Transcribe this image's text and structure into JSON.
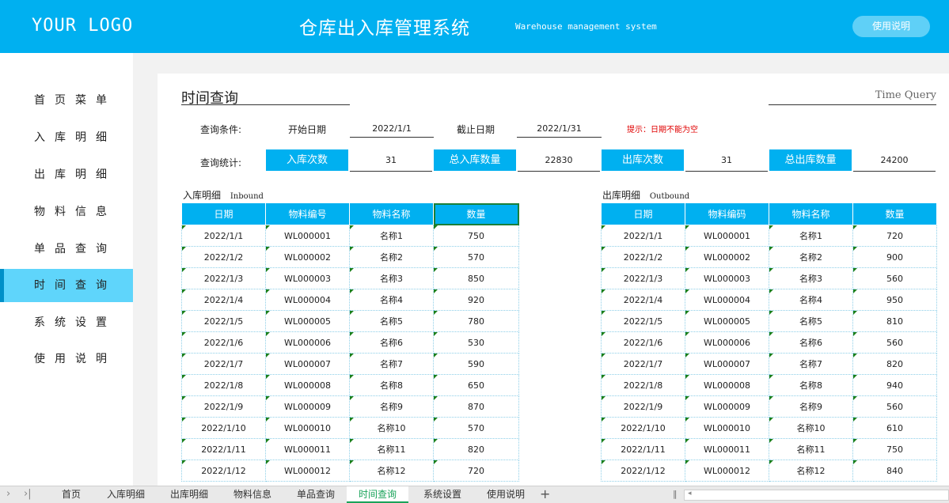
{
  "header": {
    "logo": "YOUR LOGO",
    "title": "仓库出入库管理系统",
    "subtitle": "Warehouse management system",
    "help_button": "使用说明"
  },
  "sidebar": {
    "items": [
      {
        "label": "首页菜单",
        "active": false
      },
      {
        "label": "入库明细",
        "active": false
      },
      {
        "label": "出库明细",
        "active": false
      },
      {
        "label": "物料信息",
        "active": false
      },
      {
        "label": "单品查询",
        "active": false
      },
      {
        "label": "时间查询",
        "active": true
      },
      {
        "label": "系统设置",
        "active": false
      },
      {
        "label": "使用说明",
        "active": false
      }
    ]
  },
  "query": {
    "title": "时间查询",
    "title_en": "Time Query",
    "condition_label": "查询条件:",
    "start_label": "开始日期",
    "start_value": "2022/1/1",
    "end_label": "截止日期",
    "end_value": "2022/1/31",
    "tip": "提示：日期不能为空",
    "stats_label": "查询统计:",
    "stats": [
      {
        "label": "入库次数",
        "value": "31"
      },
      {
        "label": "总入库数量",
        "value": "22830"
      },
      {
        "label": "出库次数",
        "value": "31"
      },
      {
        "label": "总出库数量",
        "value": "24200"
      }
    ]
  },
  "inbound": {
    "title": "入库明细",
    "title_en": "Inbound",
    "columns": [
      "日期",
      "物料编号",
      "物料名称",
      "数量"
    ],
    "rows": [
      [
        "2022/1/1",
        "WL000001",
        "名称1",
        "750"
      ],
      [
        "2022/1/2",
        "WL000002",
        "名称2",
        "570"
      ],
      [
        "2022/1/3",
        "WL000003",
        "名称3",
        "850"
      ],
      [
        "2022/1/4",
        "WL000004",
        "名称4",
        "920"
      ],
      [
        "2022/1/5",
        "WL000005",
        "名称5",
        "780"
      ],
      [
        "2022/1/6",
        "WL000006",
        "名称6",
        "530"
      ],
      [
        "2022/1/7",
        "WL000007",
        "名称7",
        "590"
      ],
      [
        "2022/1/8",
        "WL000008",
        "名称8",
        "650"
      ],
      [
        "2022/1/9",
        "WL000009",
        "名称9",
        "870"
      ],
      [
        "2022/1/10",
        "WL000010",
        "名称10",
        "570"
      ],
      [
        "2022/1/11",
        "WL000011",
        "名称11",
        "820"
      ],
      [
        "2022/1/12",
        "WL000012",
        "名称12",
        "720"
      ]
    ]
  },
  "outbound": {
    "title": "出库明细",
    "title_en": "Outbound",
    "columns": [
      "日期",
      "物料编码",
      "物料名称",
      "数量"
    ],
    "rows": [
      [
        "2022/1/1",
        "WL000001",
        "名称1",
        "720"
      ],
      [
        "2022/1/2",
        "WL000002",
        "名称2",
        "900"
      ],
      [
        "2022/1/3",
        "WL000003",
        "名称3",
        "560"
      ],
      [
        "2022/1/4",
        "WL000004",
        "名称4",
        "950"
      ],
      [
        "2022/1/5",
        "WL000005",
        "名称5",
        "810"
      ],
      [
        "2022/1/6",
        "WL000006",
        "名称6",
        "560"
      ],
      [
        "2022/1/7",
        "WL000007",
        "名称7",
        "820"
      ],
      [
        "2022/1/8",
        "WL000008",
        "名称8",
        "940"
      ],
      [
        "2022/1/9",
        "WL000009",
        "名称9",
        "560"
      ],
      [
        "2022/1/10",
        "WL000010",
        "名称10",
        "610"
      ],
      [
        "2022/1/11",
        "WL000011",
        "名称11",
        "750"
      ],
      [
        "2022/1/12",
        "WL000012",
        "名称12",
        "840"
      ]
    ]
  },
  "sheet_tabs": [
    {
      "label": "首页",
      "active": false
    },
    {
      "label": "入库明细",
      "active": false
    },
    {
      "label": "出库明细",
      "active": false
    },
    {
      "label": "物料信息",
      "active": false
    },
    {
      "label": "单品查询",
      "active": false
    },
    {
      "label": "时间查询",
      "active": true
    },
    {
      "label": "系统设置",
      "active": false
    },
    {
      "label": "使用说明",
      "active": false
    }
  ],
  "tabbar_icons": {
    "prev": "chevron-right-icon",
    "last": "skip-end-icon",
    "add": "plus-icon"
  },
  "colors": {
    "accent": "#00b0f0",
    "active_nav": "#5fd5fb",
    "tip": "#e00000",
    "active_tab": "#1aa35a"
  }
}
